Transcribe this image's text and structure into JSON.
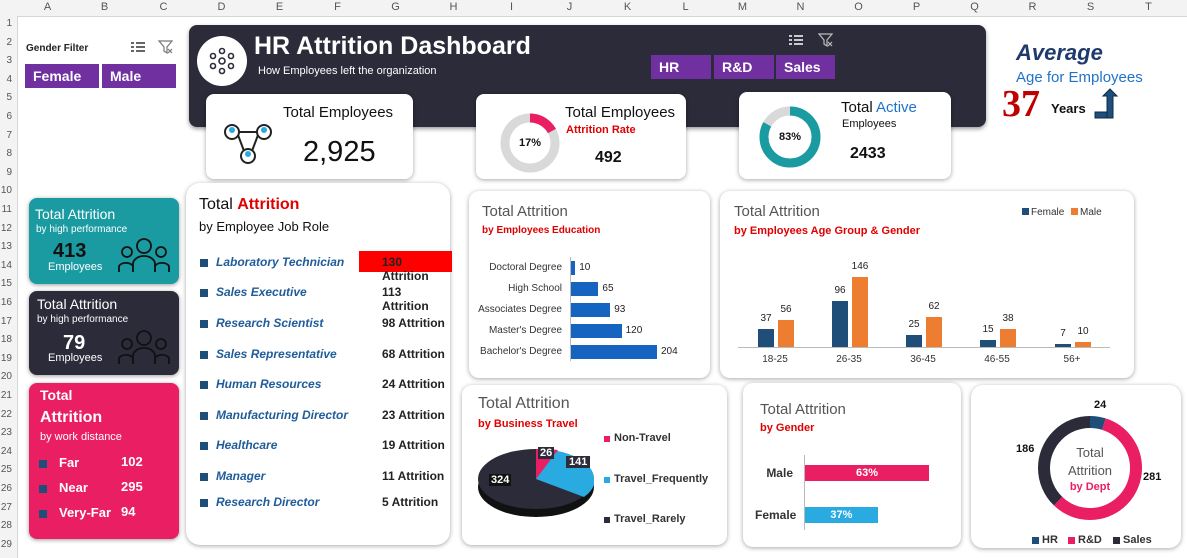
{
  "sheet": {
    "columns": [
      "A",
      "B",
      "C",
      "D",
      "E",
      "F",
      "G",
      "H",
      "I",
      "J",
      "K",
      "L",
      "M",
      "N",
      "O",
      "P",
      "Q",
      "R",
      "S",
      "T"
    ],
    "rows": [
      "1",
      "2",
      "3",
      "4",
      "5",
      "6",
      "7",
      "8",
      "9",
      "10",
      "11",
      "12",
      "13",
      "14",
      "15",
      "16",
      "17",
      "18",
      "19",
      "20",
      "21",
      "22",
      "23",
      "24",
      "25",
      "26",
      "27",
      "28",
      "29"
    ]
  },
  "gender_filter": {
    "label": "Gender Filter",
    "options": [
      "Female",
      "Male"
    ]
  },
  "header": {
    "title": "HR Attrition Dashboard",
    "subtitle": "How Employees left the organization",
    "dept_buttons": [
      "HR",
      "R&D",
      "Sales"
    ]
  },
  "average_age": {
    "title": "Average",
    "subtitle": "Age for Employees",
    "value": "37",
    "unit": "Years"
  },
  "kpi_total_employees": {
    "title": "Total Employees",
    "value": "2,925"
  },
  "kpi_attrition_rate": {
    "title": "Total Employees",
    "subtitle": "Attrition Rate",
    "percent": "17%",
    "value": "492",
    "fraction": 0.17
  },
  "kpi_active": {
    "title_a": "Total ",
    "title_b": "Active",
    "subtitle": "Employees",
    "percent": "83%",
    "value": "2433",
    "fraction": 0.83
  },
  "high_perf_1": {
    "title": "Total Attrition",
    "subtitle": "by high performance",
    "value": "413",
    "unit": "Employees"
  },
  "high_perf_2": {
    "title": "Total Attrition",
    "subtitle": "by high performance",
    "value": "79",
    "unit": "Employees"
  },
  "work_distance": {
    "title_a": "Total",
    "title_b": "Attrition",
    "subtitle": "by work distance",
    "items": [
      {
        "label": "Far",
        "value": "102"
      },
      {
        "label": "Near",
        "value": "295"
      },
      {
        "label": "Very-Far",
        "value": "94"
      }
    ]
  },
  "job_role": {
    "title_a": "Total ",
    "title_b": "Attrition",
    "subtitle": "by Employee Job Role",
    "items": [
      {
        "role": "Laboratory Technician",
        "value": "130 Attrition"
      },
      {
        "role": "Sales Executive",
        "value": "113 Attrition"
      },
      {
        "role": "Research Scientist",
        "value": "98 Attrition"
      },
      {
        "role": "Sales Representative",
        "value": "68 Attrition"
      },
      {
        "role": "Human Resources",
        "value": "24 Attrition"
      },
      {
        "role": "Manufacturing Director",
        "value": "23 Attrition"
      },
      {
        "role": "Healthcare",
        "value": "19 Attrition"
      },
      {
        "role": "Manager",
        "value": "11 Attrition"
      },
      {
        "role": "Research Director",
        "value": "5 Attrition"
      }
    ]
  },
  "education": {
    "title": "Total Attrition",
    "subtitle": "by Employees Education"
  },
  "age_gender": {
    "title": "Total Attrition",
    "subtitle": "by Employees Age Group & Gender"
  },
  "travel": {
    "title_a": "Total",
    "title_b": " Attrition",
    "subtitle": "by Business Travel"
  },
  "gender_chart": {
    "title": "Total Attrition",
    "subtitle": "by Gender"
  },
  "dept_chart": {
    "center_a": "Total",
    "center_b": "Attrition",
    "center_c": "by Dept"
  },
  "colors": {
    "purple": "#7030a0",
    "navy": "#2b2b3a",
    "pink": "#e91e63",
    "teal": "#1a9ba1",
    "blue": "#1565c0",
    "female": "#1f4e79",
    "male": "#ed7d31",
    "red": "#e00000",
    "sky": "#29abe2"
  },
  "chart_data": [
    {
      "type": "bar",
      "title": "Total Attrition",
      "subtitle": "by Employees Education",
      "categories": [
        "Doctoral Degree",
        "High School",
        "Associates Degree",
        "Master's Degree",
        "Bachelor's Degree"
      ],
      "values": [
        10,
        65,
        93,
        120,
        204
      ]
    },
    {
      "type": "bar",
      "title": "Total Attrition",
      "subtitle": "by Employees Age Group & Gender",
      "categories": [
        "18-25",
        "26-35",
        "36-45",
        "46-55",
        "56+"
      ],
      "series": [
        {
          "name": "Female",
          "values": [
            37,
            96,
            25,
            15,
            7
          ]
        },
        {
          "name": "Male",
          "values": [
            56,
            146,
            62,
            38,
            10
          ]
        }
      ],
      "legend": "top-right"
    },
    {
      "type": "pie",
      "title": "Total Attrition",
      "subtitle": "by Business Travel",
      "categories": [
        "Non-Travel",
        "Travel_Frequently",
        "Travel_Rarely"
      ],
      "values": [
        26,
        141,
        324
      ]
    },
    {
      "type": "bar",
      "title": "Total Attrition",
      "subtitle": "by Gender",
      "categories": [
        "Male",
        "Female"
      ],
      "values": [
        63,
        37
      ],
      "labels": [
        "63%",
        "37%"
      ]
    },
    {
      "type": "pie",
      "title": "Total Attrition",
      "subtitle": "by Dept",
      "categories": [
        "HR",
        "R&D",
        "Sales"
      ],
      "values": [
        24,
        281,
        186
      ],
      "legend": "bottom"
    }
  ]
}
